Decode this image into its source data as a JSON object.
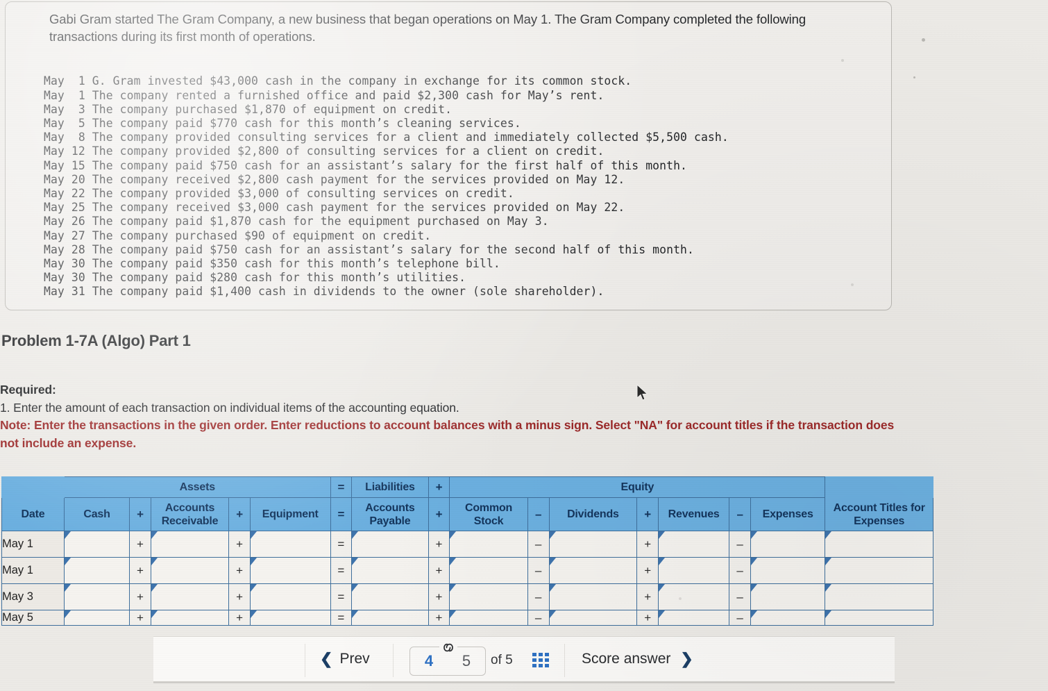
{
  "scenario": {
    "intro": "Gabi Gram started The Gram Company, a new business that began operations on May 1. The Gram Company completed the following transactions during its first month of operations.",
    "transactions_text": "May  1 G. Gram invested $43,000 cash in the company in exchange for its common stock.\nMay  1 The company rented a furnished office and paid $2,300 cash for May’s rent.\nMay  3 The company purchased $1,870 of equipment on credit.\nMay  5 The company paid $770 cash for this month’s cleaning services.\nMay  8 The company provided consulting services for a client and immediately collected $5,500 cash.\nMay 12 The company provided $2,800 of consulting services for a client on credit.\nMay 15 The company paid $750 cash for an assistant’s salary for the first half of this month.\nMay 20 The company received $2,800 cash payment for the services provided on May 12.\nMay 22 The company provided $3,000 of consulting services on credit.\nMay 25 The company received $3,000 cash payment for the services provided on May 22.\nMay 26 The company paid $1,870 cash for the equipment purchased on May 3.\nMay 27 The company purchased $90 of equipment on credit.\nMay 28 The company paid $750 cash for an assistant’s salary for the second half of this month.\nMay 30 The company paid $350 cash for this month’s telephone bill.\nMay 30 The company paid $280 cash for this month’s utilities.\nMay 31 The company paid $1,400 cash in dividends to the owner (sole shareholder).",
    "transactions": [
      {
        "date": "May  1",
        "text": "G. Gram invested $43,000 cash in the company in exchange for its common stock."
      },
      {
        "date": "May  1",
        "text": "The company rented a furnished office and paid $2,300 cash for May’s rent."
      },
      {
        "date": "May  3",
        "text": "The company purchased $1,870 of equipment on credit."
      },
      {
        "date": "May  5",
        "text": "The company paid $770 cash for this month’s cleaning services."
      },
      {
        "date": "May  8",
        "text": "The company provided consulting services for a client and immediately collected $5,500 cash."
      },
      {
        "date": "May 12",
        "text": "The company provided $2,800 of consulting services for a client on credit."
      },
      {
        "date": "May 15",
        "text": "The company paid $750 cash for an assistant’s salary for the first half of this month."
      },
      {
        "date": "May 20",
        "text": "The company received $2,800 cash payment for the services provided on May 12."
      },
      {
        "date": "May 22",
        "text": "The company provided $3,000 of consulting services on credit."
      },
      {
        "date": "May 25",
        "text": "The company received $3,000 cash payment for the services provided on May 22."
      },
      {
        "date": "May 26",
        "text": "The company paid $1,870 cash for the equipment purchased on May 3."
      },
      {
        "date": "May 27",
        "text": "The company purchased $90 of equipment on credit."
      },
      {
        "date": "May 28",
        "text": "The company paid $750 cash for an assistant’s salary for the second half of this month."
      },
      {
        "date": "May 30",
        "text": "The company paid $350 cash for this month’s telephone bill."
      },
      {
        "date": "May 30",
        "text": "The company paid $280 cash for this month’s utilities."
      },
      {
        "date": "May 31",
        "text": "The company paid $1,400 cash in dividends to the owner (sole shareholder)."
      }
    ]
  },
  "problem": {
    "title": "Problem 1-7A (Algo) Part 1",
    "required_label": "Required:",
    "requirement_1": "1. Enter the amount of each transaction on individual items of the accounting equation.",
    "note": "Note: Enter the transactions in the given order. Enter reductions to account balances with a minus sign. Select \"NA\" for account titles if the transaction does not include an expense."
  },
  "worksheet": {
    "group_headers": {
      "assets": "Assets",
      "eq1": "=",
      "liabilities": "Liabilities",
      "plus1": "+",
      "equity": "Equity"
    },
    "columns": [
      "Date",
      "Cash",
      "+",
      "Accounts Receivable",
      "+",
      "Equipment",
      "=",
      "Accounts Payable",
      "+",
      "Common Stock",
      "–",
      "Dividends",
      "+",
      "Revenues",
      "–",
      "Expenses",
      "Account Titles for Expenses"
    ],
    "rows": [
      {
        "date": "May 1",
        "cash": "",
        "ar": "",
        "equipment": "",
        "ap": "",
        "common_stock": "",
        "dividends": "",
        "revenues": "",
        "expenses": "",
        "account_title": ""
      },
      {
        "date": "May 1",
        "cash": "",
        "ar": "",
        "equipment": "",
        "ap": "",
        "common_stock": "",
        "dividends": "",
        "revenues": "",
        "expenses": "",
        "account_title": ""
      },
      {
        "date": "May 3",
        "cash": "",
        "ar": "",
        "equipment": "",
        "ap": "",
        "common_stock": "",
        "dividends": "",
        "revenues": "",
        "expenses": "",
        "account_title": ""
      },
      {
        "date": "May 5",
        "cash": "",
        "ar": "",
        "equipment": "",
        "ap": "",
        "common_stock": "",
        "dividends": "",
        "revenues": "",
        "expenses": "",
        "account_title": ""
      }
    ]
  },
  "nav": {
    "prev_label": "Prev",
    "prev_icon": "chevron-left-icon",
    "current_page": "4",
    "next_page": "5",
    "link_icon": "⚭",
    "of_label": "of 5",
    "grid_icon": "grid-icon",
    "score_label": "Score answer",
    "next_icon": "chevron-right-icon"
  },
  "colors": {
    "header_blue": "#6cb0e0",
    "header_text": "#14355c",
    "note_red": "#9c2a2a",
    "accent_blue": "#2f72c4",
    "marker_blue": "#3f74ad",
    "page_bg": "#eceae6"
  }
}
